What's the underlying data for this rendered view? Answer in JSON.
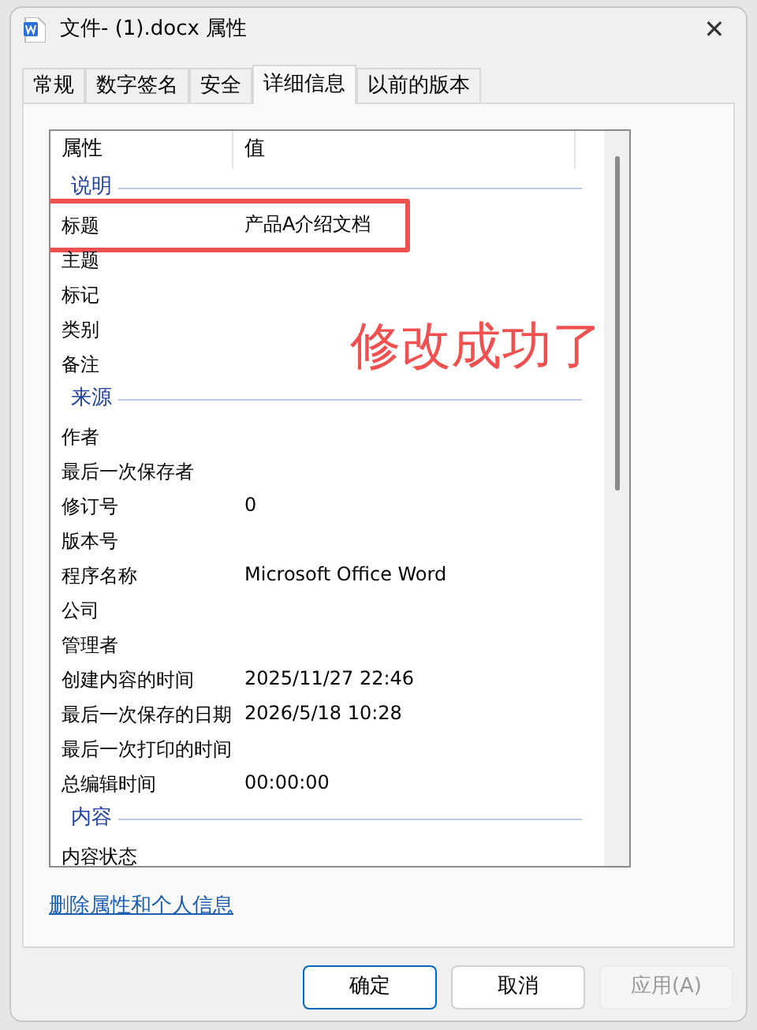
{
  "window": {
    "title": "文件- (1).docx 属性",
    "close": "✕"
  },
  "tabs": [
    {
      "label": "常规",
      "selected": false
    },
    {
      "label": "数字签名",
      "selected": false
    },
    {
      "label": "安全",
      "selected": false
    },
    {
      "label": "详细信息",
      "selected": true
    },
    {
      "label": "以前的版本",
      "selected": false
    }
  ],
  "table": {
    "columns": [
      "属性",
      "值"
    ],
    "groups": [
      {
        "heading": "说明",
        "rows": [
          {
            "property": "标题",
            "value": "产品A介绍文档",
            "highlighted": true
          },
          {
            "property": "主题",
            "highlighted": false
          },
          {
            "property": "标记",
            "highlighted": false
          },
          {
            "property": "类别",
            "highlighted": false
          },
          {
            "property": "备注",
            "highlighted": false
          }
        ]
      },
      {
        "heading": "来源",
        "rows": [
          {
            "property": "作者",
            "highlighted": false
          },
          {
            "property": "最后一次保存者",
            "highlighted": false
          },
          {
            "property": "修订号",
            "value": "0",
            "highlighted": false
          },
          {
            "property": "版本号",
            "highlighted": false
          },
          {
            "property": "程序名称",
            "value": "Microsoft Office Word",
            "highlighted": false
          },
          {
            "property": "公司",
            "highlighted": false
          },
          {
            "property": "管理者",
            "highlighted": false
          },
          {
            "property": "创建内容的时间",
            "value": "2025/11/27 22:46",
            "highlighted": false
          },
          {
            "property": "最后一次保存的日期",
            "value": "2026/5/18 10:28",
            "highlighted": false
          },
          {
            "property": "最后一次打印的时间",
            "highlighted": false
          },
          {
            "property": "总编辑时间",
            "value": "00:00:00",
            "highlighted": false
          }
        ]
      },
      {
        "heading": "内容",
        "rows": [
          {
            "property": "内容状态",
            "highlighted": false
          }
        ]
      }
    ]
  },
  "annotation": {
    "text": "修改成功了"
  },
  "link": "删除属性和个人信息",
  "buttons": [
    {
      "label": "确定",
      "kind": "default",
      "disabled": false
    },
    {
      "label": "取消",
      "kind": "normal",
      "disabled": false
    },
    {
      "label": "应用(A)",
      "kind": "normal",
      "disabled": true
    }
  ]
}
